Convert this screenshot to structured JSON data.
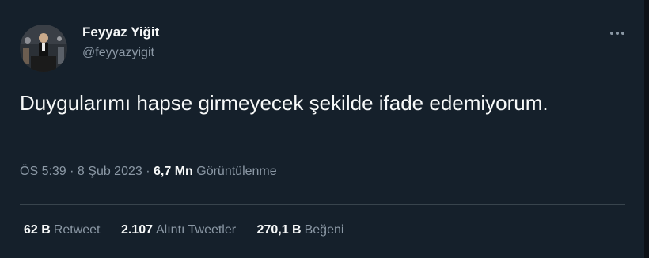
{
  "author": {
    "name": "Feyyaz Yiğit",
    "handle": "@feyyazyigit"
  },
  "tweet": {
    "text": "Duygularımı hapse girmeyecek şekilde ifade edemiyorum."
  },
  "meta": {
    "time": "ÖS 5:39",
    "sep1": " · ",
    "date": "8 Şub 2023",
    "sep2": " · ",
    "views_count": "6,7 Mn",
    "views_label": "Görüntülenme"
  },
  "stats": {
    "retweets_count": "62 B",
    "retweets_label": "Retweet",
    "quotes_count": "2.107",
    "quotes_label": "Alıntı Tweetler",
    "likes_count": "270,1 B",
    "likes_label": "Beğeni"
  },
  "icons": {
    "more": "more-options-icon"
  },
  "colors": {
    "background": "#15202b",
    "text_primary": "#f7f9f9",
    "text_secondary": "#8b98a5",
    "divider": "#38444d"
  }
}
